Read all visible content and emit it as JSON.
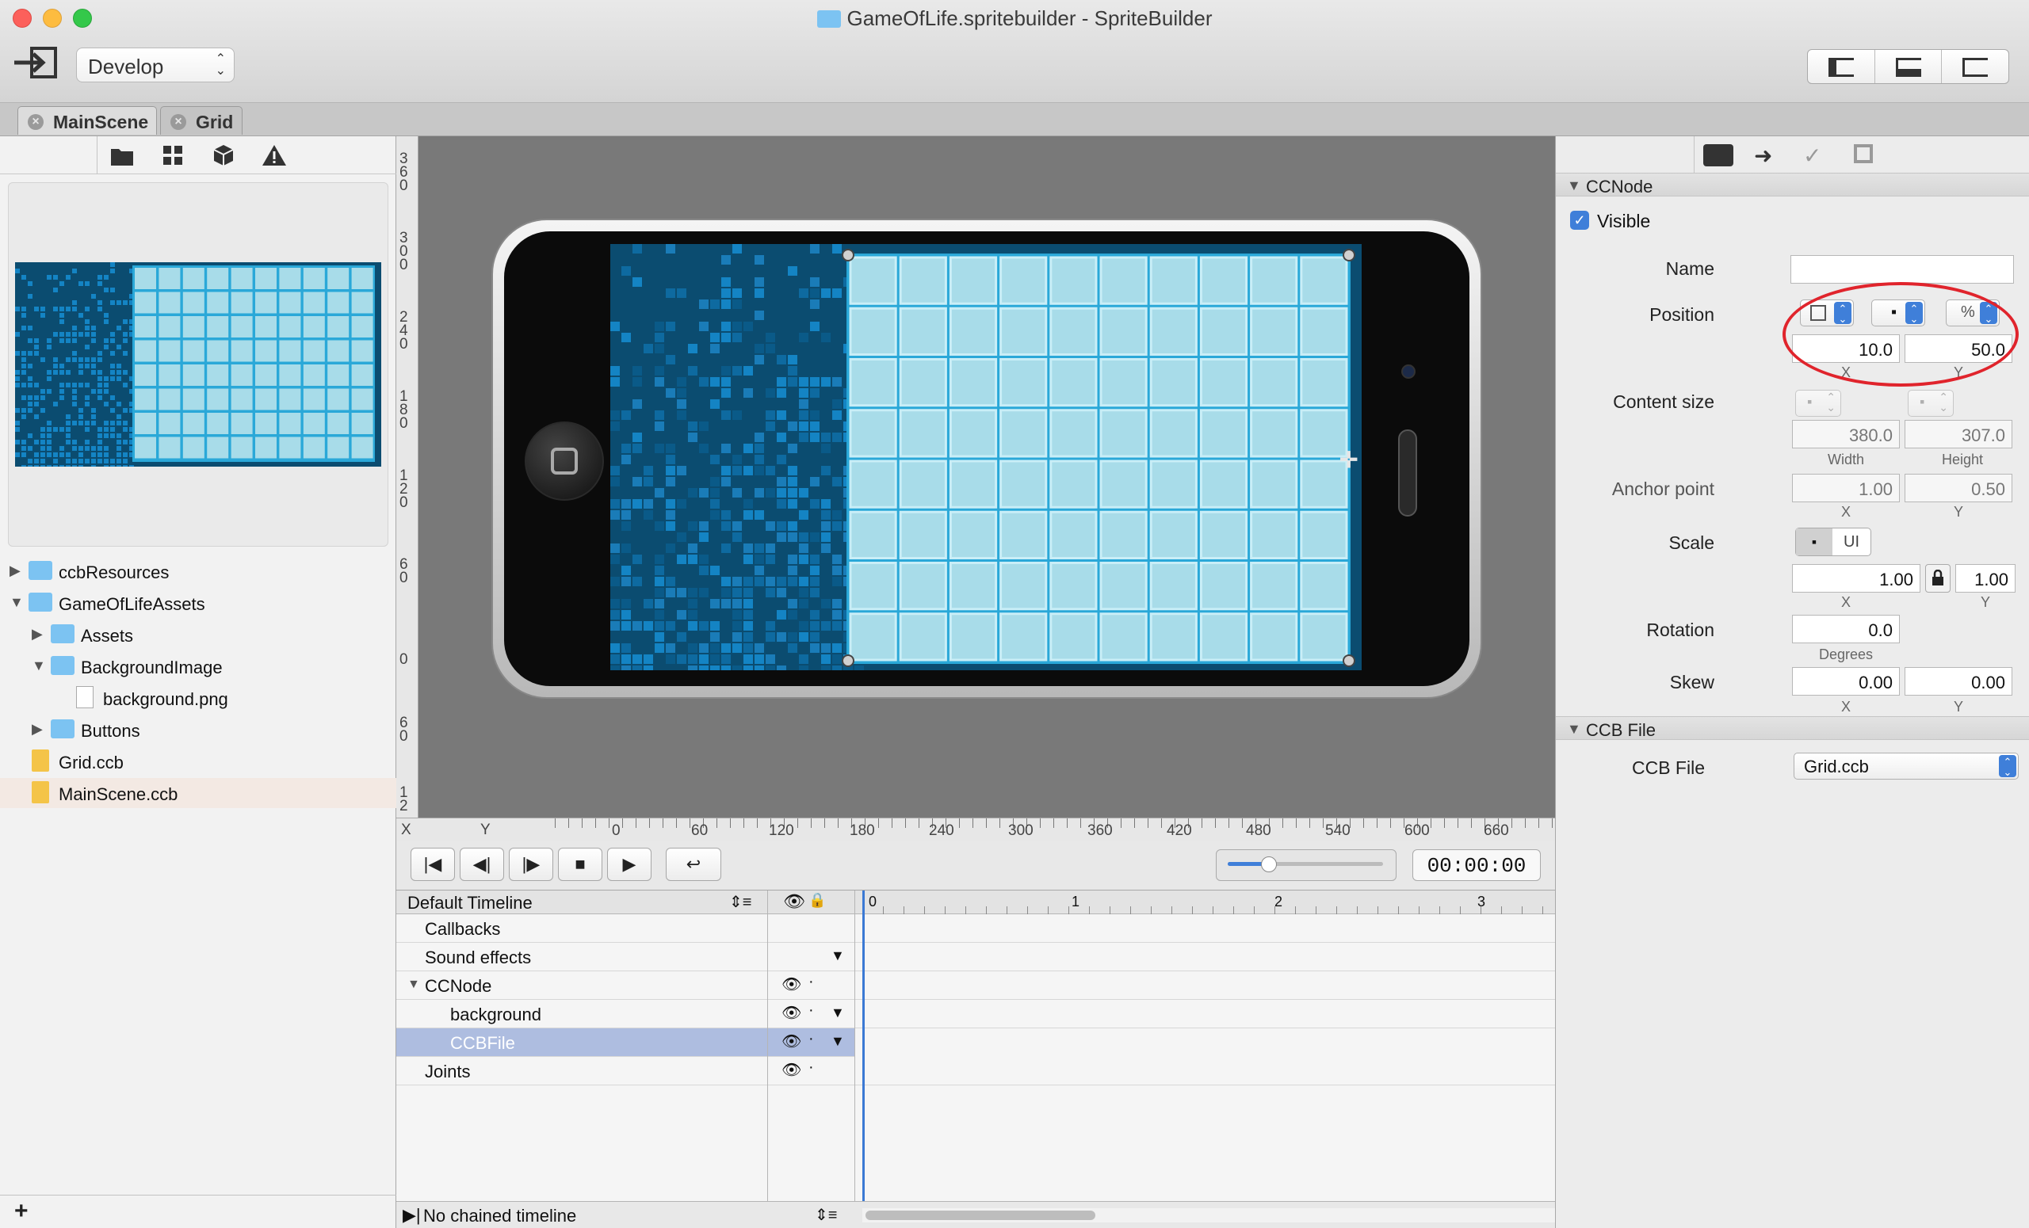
{
  "window": {
    "title": "GameOfLife.spritebuilder - SpriteBuilder",
    "traffic_colors": {
      "close": "#fc605b",
      "minimize": "#fdbc40",
      "zoom": "#34c84a"
    }
  },
  "toolbar": {
    "project_select": "Develop",
    "view_buttons": [
      "left-panel-icon",
      "bottom-panel-icon",
      "right-panel-icon"
    ]
  },
  "tabs": [
    {
      "label": "MainScene"
    },
    {
      "label": "Grid"
    }
  ],
  "left_tools": [
    "folder-icon",
    "grid-icon",
    "cube-icon",
    "warning-icon"
  ],
  "file_tree": [
    {
      "label": "ccbResources"
    },
    {
      "label": "GameOfLifeAssets"
    },
    {
      "label": "Assets"
    },
    {
      "label": "BackgroundImage"
    },
    {
      "label": "background.png"
    },
    {
      "label": "Buttons"
    },
    {
      "label": "Grid.ccb"
    },
    {
      "label": "MainScene.ccb"
    }
  ],
  "rulers": {
    "horizontal": {
      "x_label": "X",
      "y_label": "Y",
      "ticks": [
        "0",
        "60",
        "120",
        "180",
        "240",
        "300",
        "360",
        "420",
        "480",
        "540",
        "600",
        "660"
      ]
    },
    "vertical": [
      "3 6 0",
      "3 0 0",
      "2 4 0",
      "1 8 0",
      "1 2 0",
      "6 0",
      "0",
      "6 0",
      "1 2"
    ]
  },
  "playback": {
    "buttons": [
      "jump-start-icon",
      "step-back-icon",
      "step-forward-icon",
      "stop-icon",
      "play-icon",
      "loop-icon"
    ],
    "time": "00:00:00"
  },
  "timeline": {
    "header": "Default Timeline",
    "rows": [
      {
        "label": "Callbacks"
      },
      {
        "label": "Sound effects"
      },
      {
        "label": "CCNode"
      },
      {
        "label": "background"
      },
      {
        "label": "CCBFile"
      },
      {
        "label": "Joints"
      }
    ],
    "scale_ticks": [
      "0",
      "1",
      "2",
      "3"
    ],
    "footer": "No chained timeline"
  },
  "inspector": {
    "sections": {
      "ccnode": "CCNode",
      "ccbfile": "CCB File"
    },
    "visible_label": "Visible",
    "visible_checked": true,
    "name_label": "Name",
    "name_value": "",
    "position_label": "Position",
    "position_unit": "%",
    "position_x": "10.0",
    "position_y": "50.0",
    "content_size_label": "Content size",
    "content_width": "380.0",
    "content_height": "307.0",
    "anchor_label": "Anchor point",
    "anchor_x": "1.00",
    "anchor_y": "0.50",
    "scale_label": "Scale",
    "scale_ui": "UI",
    "scale_x": "1.00",
    "scale_y": "1.00",
    "rotation_label": "Rotation",
    "rotation_value": "0.0",
    "skew_label": "Skew",
    "skew_x": "0.00",
    "skew_y": "0.00",
    "sub_x": "X",
    "sub_y": "Y",
    "sub_width": "Width",
    "sub_height": "Height",
    "sub_degrees": "Degrees",
    "ccb_file_label": "CCB File",
    "ccb_file_value": "Grid.ccb",
    "highlight_color": "#e0242c"
  },
  "colors": {
    "screen_bg": "#0b4c70",
    "grid_cell": "#a8dce9",
    "grid_line": "#2aa8d8",
    "selection": "#aebde0"
  }
}
